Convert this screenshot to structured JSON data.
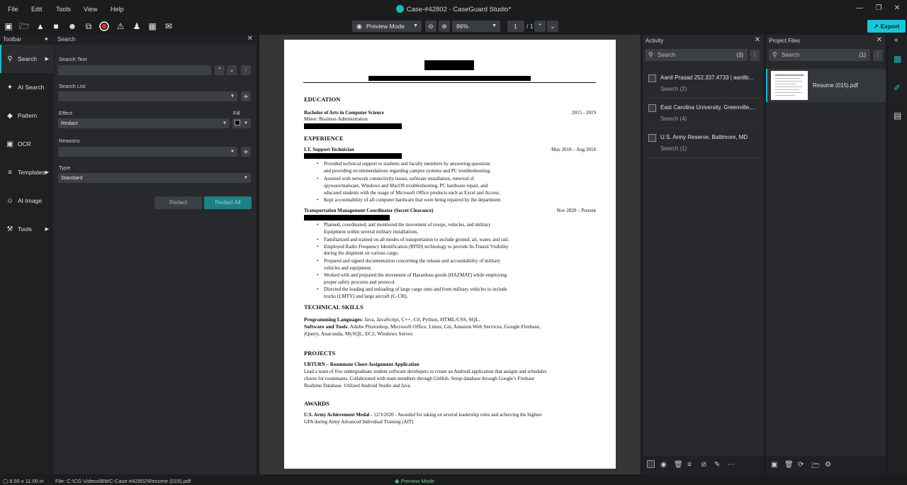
{
  "menu": [
    "File",
    "Edit",
    "Tools",
    "View",
    "Help"
  ],
  "window_title": "Case-#42802 - CaseGuard Studio*",
  "toolbar": {
    "view_mode": "Preview Mode",
    "zoom": "86%",
    "page_current": "1",
    "page_total": "/ 1",
    "export_label": "Export"
  },
  "leftnav": {
    "header": "Toolbar",
    "items": [
      {
        "label": "Search",
        "icon": "search-icon"
      },
      {
        "label": "AI Search",
        "icon": "sparkle-icon"
      },
      {
        "label": "Pattern",
        "icon": "pattern-icon"
      },
      {
        "label": "OCR",
        "icon": "ocr-icon"
      },
      {
        "label": "Templates",
        "icon": "layers-icon"
      },
      {
        "label": "AI Image",
        "icon": "face-icon"
      },
      {
        "label": "Tools",
        "icon": "wrench-icon"
      }
    ]
  },
  "search_panel": {
    "header": "Search",
    "search_text_label": "Search Text",
    "search_list_label": "Search List",
    "effect_label": "Effect",
    "effect_value": "Redact",
    "fill_label": "Fill",
    "reasons_label": "Reasons",
    "type_label": "Type",
    "type_value": "Standard",
    "redact_btn": "Redact",
    "redact_all_btn": "Redact All"
  },
  "document": {
    "education_h": "EDUCATION",
    "degree": "Bachelor of Arts in Computer Science",
    "degree_dates": "2015 - 2019",
    "minor": "Minor: Business Administration",
    "experience_h": "EXPERIENCE",
    "job1_title": "I.T. Support Technician",
    "job1_dates": "May 2018 – Aug 2018",
    "job1_b1a": "Provided technical support to students and faculty members by answering questions",
    "job1_b1b": "and providing recommendations regarding campus systems and PC troubleshooting.",
    "job1_b2a": "Assisted with network connectivity issues, software installation, removal of",
    "job1_b2b": "spyware/malware, Windows and MacOS troubleshooting, PC hardware repair, and",
    "job1_b2c": "educated students with the usage of Microsoft Office products such as Excel and Access.",
    "job1_b3": "Kept accountability of all computer hardware that were being repaired by the department.",
    "job2_title": "Transportation Management Coordinator (Secret Clearance)",
    "job2_dates": "Nov 2020 – Present",
    "job2_b1a": "Planned, coordinated, and monitored the movement of troops, vehicles, and military",
    "job2_b1b": "Equipment within several military installations.",
    "job2_b2": "Familiarized and trained on all modes of transportation to include ground, air, water, and rail.",
    "job2_b3a": "Employed Radio Frequency Identification (RFID) technology to provide In-Transit Visibility",
    "job2_b3b": "during the shipment on various cargo.",
    "job2_b4a": "Prepared and signed documentation concerning the release and accountability of military",
    "job2_b4b": "vehicles and equipment.",
    "job2_b5a": "Worked with and prepared the movement of Hazardous goods (HAZMAT) while employing",
    "job2_b5b": "proper safety procures and protocol.",
    "job2_b6a": "Directed the loading and unloading of large cargo onto and from military vehicles to include",
    "job2_b6b": "trucks (LMTV) and large aircraft (C-130).",
    "skills_h": "TECHNICAL SKILLS",
    "prog_label": "Programming Languages",
    "prog_value": ": Java, JavaScript, C++, C#, Python, HTML/CSS, SQL.",
    "tools_label": "Software and Tools",
    "tools_value": ": Adobe Photoshop, Microsoft Office, Linux, Git, Amazon Web Services, Google Firebase,",
    "tools_value2": "jQuery, Anaconda, MySQL, EC2, Windows Server.",
    "projects_h": "PROJECTS",
    "proj_title": "URTURN – Roommate Chore Assignment Application",
    "proj_l1": "Lead a team of five undergraduate student software developers to create an Android application that assigns and schedules",
    "proj_l2": "chores for roommates. Collaborated with team members through GitHub. Setup database through Google’s Firebase",
    "proj_l3": "Realtime Database. Utilized Android Studio and Java.",
    "awards_h": "AWARDS",
    "award_title": "U.S. Army Achievement Medal -",
    "award_l1": " 12/3/2020 - Awarded for taking on several leadership roles and achieving the highest",
    "award_l2": "GPA during Army Advanced Individual Training (AIT)"
  },
  "activity": {
    "header": "Activity",
    "search_placeholder": "Search",
    "count": "(3)",
    "items": [
      {
        "title": "Aanil Prasad 252.337.4733 | aanilb...",
        "sub": "Search  (2)"
      },
      {
        "title": "East Carolina University, Greenville,...",
        "sub": "Search  (4)"
      },
      {
        "title": "U.S. Army Reserve, Baltimore, MD",
        "sub": "Search  (1)"
      }
    ]
  },
  "project_files": {
    "header": "Project Files",
    "search_placeholder": "Search",
    "count": "(1)",
    "file_name": "Resume (015).pdf"
  },
  "status": {
    "page_size": "8.50 x 11.00 in",
    "file_path": "File: C:\\CG Videos\\BWC-Case-#42802\\Resume (015).pdf",
    "mode": "Preview Mode"
  }
}
